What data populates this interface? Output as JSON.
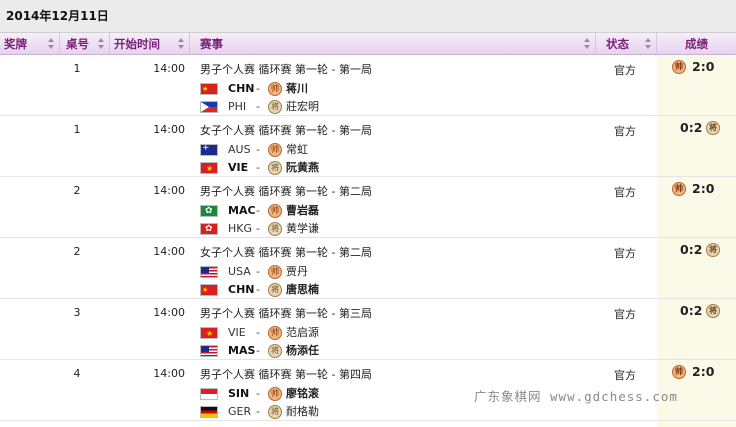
{
  "date": "2014年12月11日",
  "headers": {
    "award": "奖牌",
    "table": "桌号",
    "start_time": "开始时间",
    "event": "赛事",
    "status": "状态",
    "score": "成绩"
  },
  "badges": {
    "red": "帅",
    "black": "将"
  },
  "rows": [
    {
      "table": "1",
      "time": "14:00",
      "event": "男子个人赛 循环赛 第一轮 - 第一局",
      "status": "官方",
      "p1": {
        "country": "CHN",
        "flag": "chn",
        "name": "蒋川",
        "side": "red",
        "winner": true
      },
      "p2": {
        "country": "PHI",
        "flag": "phi",
        "name": "莊宏明",
        "side": "black",
        "winner": false
      },
      "score": "2:0",
      "score_side": "left"
    },
    {
      "table": "1",
      "time": "14:00",
      "event": "女子个人赛 循环赛 第一轮 - 第一局",
      "status": "官方",
      "p1": {
        "country": "AUS",
        "flag": "aus",
        "name": "常虹",
        "side": "red",
        "winner": false
      },
      "p2": {
        "country": "VIE",
        "flag": "vie",
        "name": "阮黄燕",
        "side": "black",
        "winner": true
      },
      "score": "0:2",
      "score_side": "right"
    },
    {
      "table": "2",
      "time": "14:00",
      "event": "男子个人赛 循环赛 第一轮 - 第二局",
      "status": "官方",
      "p1": {
        "country": "MAC",
        "flag": "mac",
        "name": "曹岩磊",
        "side": "red",
        "winner": true
      },
      "p2": {
        "country": "HKG",
        "flag": "hkg",
        "name": "黄学谦",
        "side": "black",
        "winner": false
      },
      "score": "2:0",
      "score_side": "left"
    },
    {
      "table": "2",
      "time": "14:00",
      "event": "女子个人赛 循环赛 第一轮 - 第二局",
      "status": "官方",
      "p1": {
        "country": "USA",
        "flag": "usa",
        "name": "贾丹",
        "side": "red",
        "winner": false
      },
      "p2": {
        "country": "CHN",
        "flag": "chn",
        "name": "唐思楠",
        "side": "black",
        "winner": true
      },
      "score": "0:2",
      "score_side": "right"
    },
    {
      "table": "3",
      "time": "14:00",
      "event": "男子个人赛 循环赛 第一轮 - 第三局",
      "status": "官方",
      "p1": {
        "country": "VIE",
        "flag": "vie",
        "name": "范启源",
        "side": "red",
        "winner": false
      },
      "p2": {
        "country": "MAS",
        "flag": "mas",
        "name": "杨添任",
        "side": "black",
        "winner": true
      },
      "score": "0:2",
      "score_side": "right"
    },
    {
      "table": "4",
      "time": "14:00",
      "event": "男子个人赛 循环赛 第一轮 - 第四局",
      "status": "官方",
      "p1": {
        "country": "SIN",
        "flag": "sin",
        "name": "廖铭滚",
        "side": "red",
        "winner": true
      },
      "p2": {
        "country": "GER",
        "flag": "ger",
        "name": "耐格勒",
        "side": "black",
        "winner": false
      },
      "score": "2:0",
      "score_side": "left"
    }
  ],
  "watermark": "广东象棋网 www.gdchess.com"
}
